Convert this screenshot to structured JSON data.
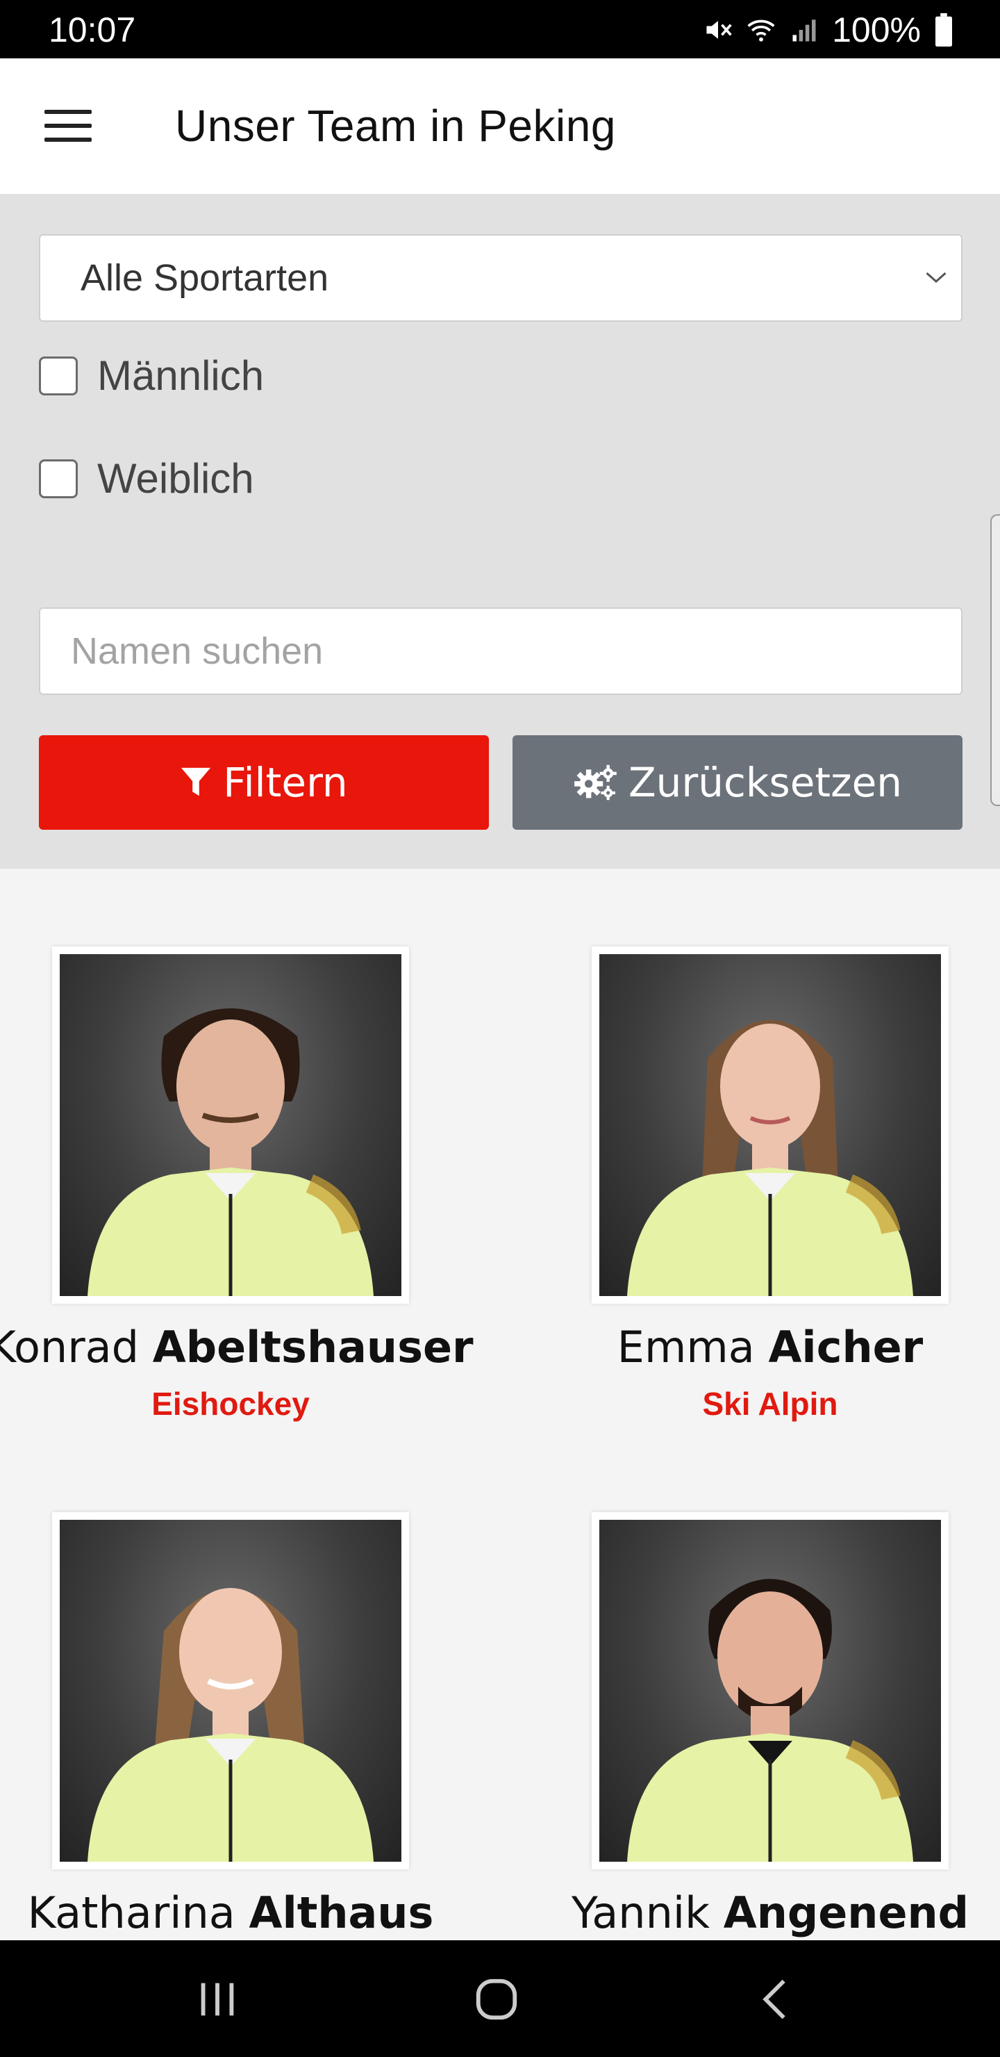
{
  "status": {
    "time": "10:07",
    "battery": "100%"
  },
  "app": {
    "title": "Unser Team in Peking"
  },
  "filter": {
    "sport_select": "Alle Sportarten",
    "male_label": "Männlich",
    "female_label": "Weiblich",
    "search_placeholder": "Namen suchen",
    "filter_button": "Filtern",
    "reset_button": "Zurücksetzen"
  },
  "athletes": [
    {
      "first": "Konrad",
      "last": "Abeltshauser",
      "sport": "Eishockey"
    },
    {
      "first": "Emma",
      "last": "Aicher",
      "sport": "Ski Alpin"
    },
    {
      "first": "Katharina",
      "last": "Althaus",
      "sport": ""
    },
    {
      "first": "Yannik",
      "last": "Angenend",
      "sport": ""
    }
  ],
  "colors": {
    "accent": "#e8160b",
    "secondary": "#6c727a",
    "jacket": "#e6f2a5"
  },
  "icons": {
    "menu": "hamburger-icon",
    "filter": "funnel-icon",
    "reset": "gears-icon",
    "chevron": "chevron-down-icon"
  }
}
